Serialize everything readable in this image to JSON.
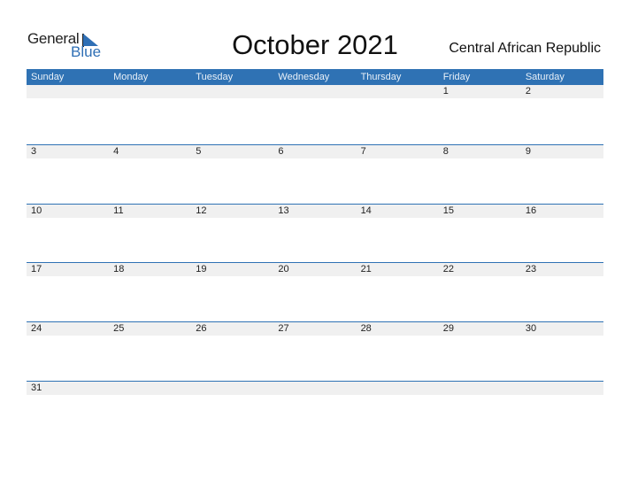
{
  "logo": {
    "line1": "General",
    "line2": "Blue"
  },
  "title": "October 2021",
  "country": "Central African Republic",
  "colors": {
    "accent": "#2f72b4",
    "strip": "#f0f0f0"
  },
  "weekdays": [
    "Sunday",
    "Monday",
    "Tuesday",
    "Wednesday",
    "Thursday",
    "Friday",
    "Saturday"
  ],
  "weeks": [
    [
      "",
      "",
      "",
      "",
      "",
      "1",
      "2"
    ],
    [
      "3",
      "4",
      "5",
      "6",
      "7",
      "8",
      "9"
    ],
    [
      "10",
      "11",
      "12",
      "13",
      "14",
      "15",
      "16"
    ],
    [
      "17",
      "18",
      "19",
      "20",
      "21",
      "22",
      "23"
    ],
    [
      "24",
      "25",
      "26",
      "27",
      "28",
      "29",
      "30"
    ],
    [
      "31",
      "",
      "",
      "",
      "",
      "",
      ""
    ]
  ]
}
